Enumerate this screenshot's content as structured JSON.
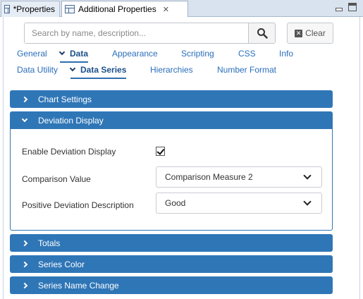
{
  "tabs": [
    {
      "label": "*Properties"
    },
    {
      "label": "Additional Properties"
    }
  ],
  "search": {
    "placeholder": "Search by name, description...",
    "value": "",
    "clear_label": "Clear"
  },
  "nav": {
    "row1": [
      "General",
      "Data",
      "Appearance",
      "Scripting",
      "CSS",
      "Info"
    ],
    "row2": [
      "Data Utility",
      "Data Series",
      "Hierarchies",
      "Number Format"
    ],
    "selected_row1": "Data",
    "selected_row2": "Data Series"
  },
  "sections": {
    "chart_settings": "Chart Settings",
    "deviation_display": "Deviation Display",
    "totals": "Totals",
    "series_color": "Series Color",
    "series_name_change": "Series Name Change"
  },
  "deviation": {
    "enable_label": "Enable Deviation Display",
    "enable_checked": true,
    "comparison_label": "Comparison Value",
    "comparison_value": "Comparison Measure 2",
    "positive_label": "Positive Deviation Description",
    "positive_value": "Good"
  },
  "colors": {
    "accent": "#2f76b7",
    "link": "#2a6ebb"
  }
}
